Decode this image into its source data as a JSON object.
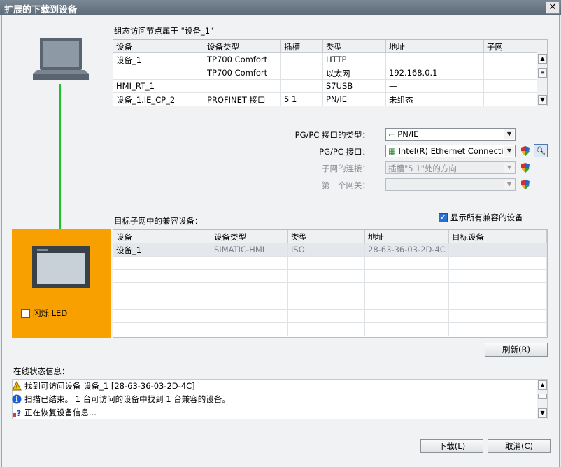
{
  "window": {
    "title": "扩展的下载到设备",
    "close_label": "✕"
  },
  "top_section": {
    "title": "组态访问节点属于 \"设备_1\"",
    "columns": [
      "设备",
      "设备类型",
      "插槽",
      "类型",
      "地址",
      "子网"
    ],
    "rows": [
      [
        "设备_1",
        "TP700 Comfort",
        "",
        "HTTP",
        "",
        ""
      ],
      [
        "",
        "TP700 Comfort",
        "",
        "以太网",
        "192.168.0.1",
        ""
      ],
      [
        "HMI_RT_1",
        "",
        "",
        "S7USB",
        "—",
        ""
      ],
      [
        "设备_1.IE_CP_2",
        "PROFINET 接口",
        "5 1",
        "PN/IE",
        "未组态",
        ""
      ]
    ]
  },
  "connection": {
    "pgpc_type_label": "PG/PC 接口的类型：",
    "pgpc_type_value": "PN/IE",
    "pgpc_if_label": "PG/PC 接口：",
    "pgpc_if_value": "Intel(R) Ethernet Connecti...",
    "subnet_label": "子网的连接：",
    "subnet_value": "插槽\"5 1\"处的方向",
    "gateway_label": "第一个网关：",
    "gateway_value": ""
  },
  "target_section": {
    "title": "目标子网中的兼容设备：",
    "show_all_label": "显示所有兼容的设备",
    "show_all_checked": true,
    "columns": [
      "设备",
      "设备类型",
      "类型",
      "地址",
      "目标设备"
    ],
    "rows": [
      [
        "设备_1",
        "SIMATIC-HMI",
        "ISO",
        "28-63-36-03-2D-4C",
        "—"
      ]
    ],
    "flash_led_label": "闪烁 LED",
    "refresh_label": "刷新(R)"
  },
  "status": {
    "title": "在线状态信息：",
    "messages": [
      {
        "icon": "warning-icon",
        "text": "找到可访问设备 设备_1 [28-63-36-03-2D-4C]"
      },
      {
        "icon": "info-icon",
        "text": "扫描已结束。 1 台可访问的设备中找到 1 台兼容的设备。"
      },
      {
        "icon": "progress-icon",
        "text": "正在恢复设备信息..."
      }
    ]
  },
  "buttons": {
    "download_label": "下载(L)",
    "cancel_label": "取消(C)"
  },
  "colors": {
    "accent_orange": "#f8a000",
    "link_green": "#22c02a",
    "title_bar": "#6b7886"
  }
}
